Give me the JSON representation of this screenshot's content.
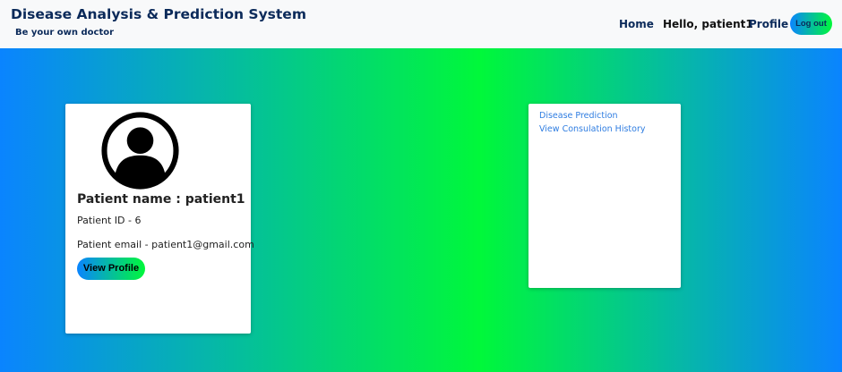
{
  "navbar": {
    "title": "Disease Analysis & Prediction System",
    "tagline": "Be your own doctor",
    "links": {
      "home": "Home",
      "greeting": "Hello, patient1",
      "profile": "Profile",
      "logout": "Log out"
    }
  },
  "profile_card": {
    "avatar_icon": "user-avatar-icon",
    "name_line": "Patient name : patient1",
    "id_line": "Patient ID - 6",
    "email_line": "Patient email - patient1@gmail.com",
    "view_profile_label": "View Profile"
  },
  "side_menu": {
    "items": [
      {
        "label": "Disease Prediction"
      },
      {
        "label": "View Consulation History"
      }
    ]
  },
  "colors": {
    "gradient_blue": "#0a84ff",
    "gradient_green": "#00f83a",
    "nav_text": "#0b2a5a",
    "link_blue": "#2f7de1"
  }
}
